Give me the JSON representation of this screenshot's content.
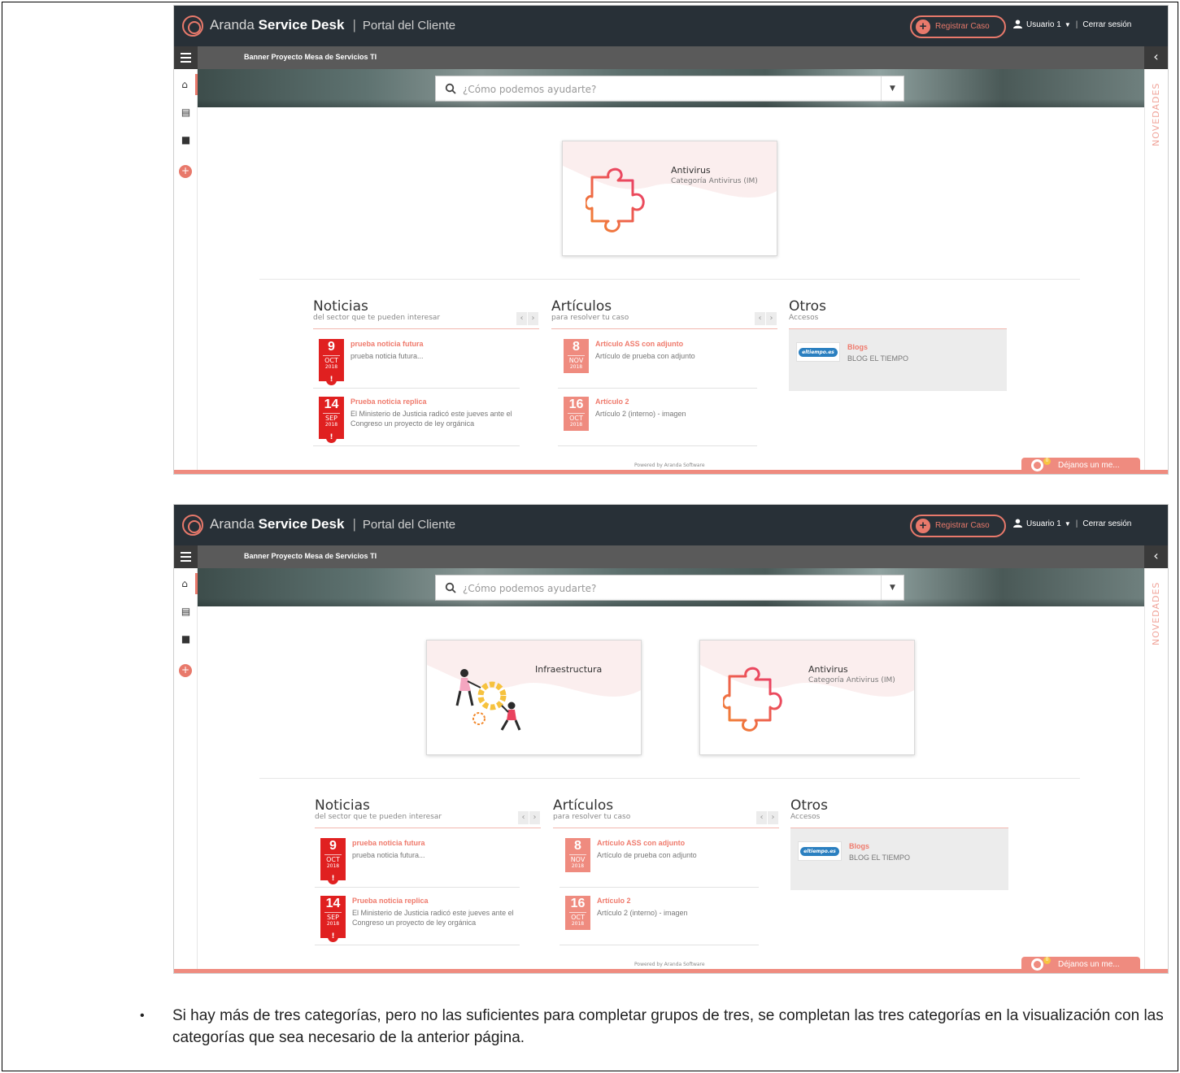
{
  "shots": [
    {
      "app": {
        "brand_light": "Aranda",
        "brand_bold": "Service Desk",
        "separator": "|",
        "portal": "Portal del Cliente"
      },
      "topbar": {
        "register_label": "Registrar Caso",
        "user_label": "Usuario 1",
        "separator": "|",
        "logout_label": "Cerrar sesión"
      },
      "subbar": {
        "banner_title": "Banner Proyecto Mesa de Servicios TI"
      },
      "search": {
        "placeholder": "¿Cómo podemos ayudarte?"
      },
      "right_rail": {
        "label": "NOVEDADES"
      },
      "categories": [
        {
          "name": "Antivirus",
          "desc": "Categoría Antivirus (IM)",
          "icon": "puzzle-icon"
        }
      ],
      "noticias": {
        "title": "Noticias",
        "subtitle": "del sector que te pueden interesar",
        "items": [
          {
            "day": "9",
            "month": "OCT",
            "year": "2018",
            "title": "prueba noticia futura",
            "desc": "prueba noticia futura..."
          },
          {
            "day": "14",
            "month": "SEP",
            "year": "2018",
            "title": "Prueba noticia replica",
            "desc": "El Ministerio de Justicia radicó este jueves ante el Congreso un proyecto de ley orgánica"
          }
        ]
      },
      "articulos": {
        "title": "Artículos",
        "subtitle": "para resolver tu caso",
        "items": [
          {
            "day": "8",
            "month": "NOV",
            "year": "2018",
            "title": "Artículo ASS con adjunto",
            "desc": "Artículo de prueba con adjunto"
          },
          {
            "day": "16",
            "month": "OCT",
            "year": "2018",
            "title": "Artículo 2",
            "desc": "Artículo 2 (interno) - imagen"
          }
        ]
      },
      "otros": {
        "title": "Otros",
        "subtitle": "Accesos",
        "items": [
          {
            "logo_text": "eltiempo.es",
            "title": "Blogs",
            "desc": "BLOG EL TIEMPO"
          }
        ]
      },
      "footer": {
        "powered": "Powered by Aranda Software",
        "chat_label": "Déjanos un me...",
        "chat_count": "0"
      }
    },
    {
      "app": {
        "brand_light": "Aranda",
        "brand_bold": "Service Desk",
        "separator": "|",
        "portal": "Portal del Cliente"
      },
      "topbar": {
        "register_label": "Registrar Caso",
        "user_label": "Usuario 1",
        "separator": "|",
        "logout_label": "Cerrar sesión"
      },
      "subbar": {
        "banner_title": "Banner Proyecto Mesa de Servicios TI"
      },
      "search": {
        "placeholder": "¿Cómo podemos ayudarte?"
      },
      "right_rail": {
        "label": "NOVEDADES"
      },
      "categories": [
        {
          "name": "Infraestructura",
          "desc": "",
          "icon": "people-gears-icon"
        },
        {
          "name": "Antivirus",
          "desc": "Categoría Antivirus (IM)",
          "icon": "puzzle-icon"
        }
      ],
      "noticias": {
        "title": "Noticias",
        "subtitle": "del sector que te pueden interesar",
        "items": [
          {
            "day": "9",
            "month": "OCT",
            "year": "2018",
            "title": "prueba noticia futura",
            "desc": "prueba noticia futura..."
          },
          {
            "day": "14",
            "month": "SEP",
            "year": "2018",
            "title": "Prueba noticia replica",
            "desc": "El Ministerio de Justicia radicó este jueves ante el Congreso un proyecto de ley orgánica"
          }
        ]
      },
      "articulos": {
        "title": "Artículos",
        "subtitle": "para resolver tu caso",
        "items": [
          {
            "day": "8",
            "month": "NOV",
            "year": "2018",
            "title": "Artículo ASS con adjunto",
            "desc": "Artículo de prueba con adjunto"
          },
          {
            "day": "16",
            "month": "OCT",
            "year": "2018",
            "title": "Artículo 2",
            "desc": "Artículo 2 (interno) - imagen"
          }
        ]
      },
      "otros": {
        "title": "Otros",
        "subtitle": "Accesos",
        "items": [
          {
            "logo_text": "eltiempo.es",
            "title": "Blogs",
            "desc": "BLOG EL TIEMPO"
          }
        ]
      },
      "footer": {
        "powered": "Powered by Aranda Software",
        "chat_label": "Déjanos un me...",
        "chat_count": "0"
      }
    }
  ],
  "caption": {
    "bullet": "•",
    "text": "Si hay más de tres categorías, pero no las suficientes para completar grupos de tres, se completan las tres categorías en la visualización con las categorías que sea necesario de la anterior página."
  },
  "colors": {
    "accent": "#e8796b",
    "topbar": "#283037",
    "subbar": "#5a5a5a",
    "news_badge": "#e02020",
    "article_badge": "#ef8b7f"
  }
}
